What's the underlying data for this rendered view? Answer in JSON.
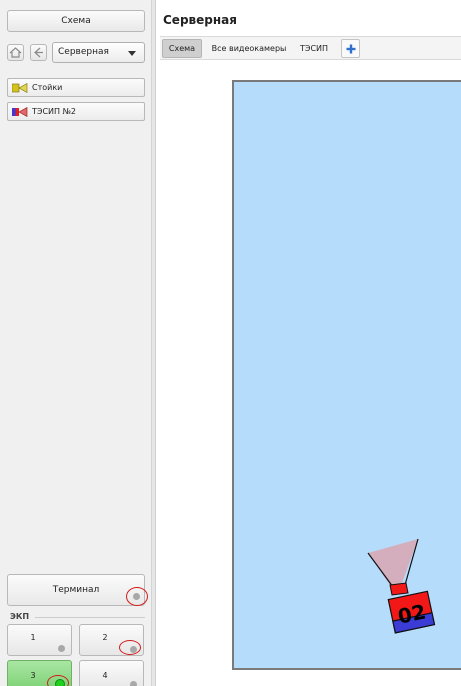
{
  "sidebar": {
    "schema_button": "Схема",
    "room_select": {
      "value": "Серверная"
    },
    "objects": [
      {
        "label": "Стойки",
        "icon": "camera-yellow-icon"
      },
      {
        "label": "ТЭСИП №2",
        "icon": "camera-red-blue-icon"
      }
    ],
    "terminal_button": "Терминал",
    "group_label": "ЭКП",
    "tiles": [
      {
        "number": "1",
        "state": "off"
      },
      {
        "number": "2",
        "state": "off"
      },
      {
        "number": "3",
        "state": "active"
      },
      {
        "number": "4",
        "state": "off"
      }
    ]
  },
  "main": {
    "title": "Серверная",
    "tabs": [
      {
        "label": "Схема",
        "active": true
      },
      {
        "label": "Все видеокамеры",
        "active": false
      },
      {
        "label": "ТЭСИП",
        "active": false
      }
    ],
    "add_tab_icon": "plus-icon",
    "plan": {
      "camera": {
        "label": "02"
      }
    }
  },
  "colors": {
    "plan_fill": "#b5dcfa",
    "plan_border": "#7a7a7a",
    "active_tile": "#7fd276",
    "active_indicator": "#1fd11f",
    "marker_ring": "#d21c1c",
    "camera_red": "#f21818",
    "camera_blue": "#3b3bd6"
  }
}
